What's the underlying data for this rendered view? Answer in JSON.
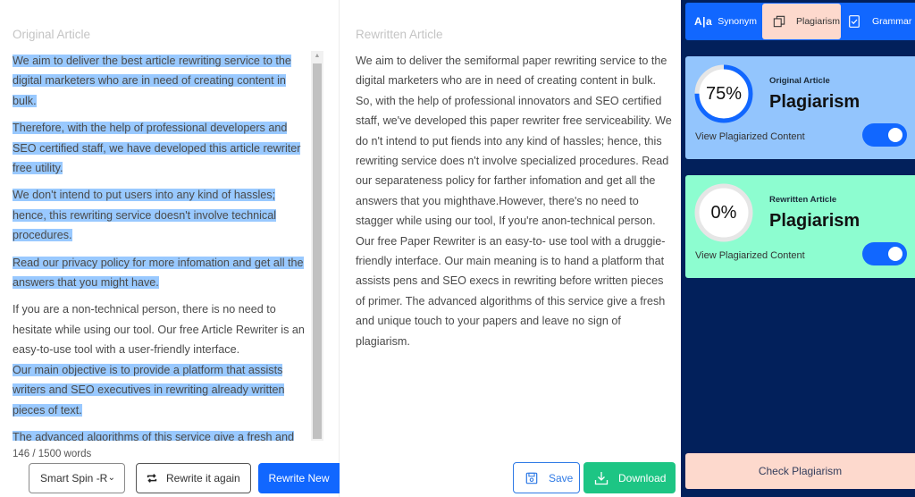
{
  "original": {
    "title": "Original Article",
    "paragraphs": [
      {
        "text": "We aim to deliver the best article rewriting service to the digital marketers who are in need of creating content in bulk.",
        "highlighted": true
      },
      {
        "text": "Therefore, with the help of professional developers and SEO certified staff, we have developed this article rewriter free utility.",
        "highlighted": true
      },
      {
        "text": "We don't intend to put users into any kind of hassles; hence, this rewriting service doesn't involve technical procedures.",
        "highlighted": true
      },
      {
        "text": "Read our privacy policy for more infomation and get all the answers that you might have.",
        "highlighted": true
      },
      {
        "text": "If you are a non-technical person, there is no need to hesitate while using our tool. Our free Article Rewriter is an easy-to-use tool with a user-friendly interface.",
        "highlighted": false
      },
      {
        "text": "Our main objective is to provide a platform that assists writers and SEO executives in rewriting already written pieces of text.",
        "highlighted": true
      },
      {
        "text": "The advanced algorithms of this service give a fresh and unique touch to your papers and leave no sign of plagiarism.",
        "highlighted": true
      }
    ],
    "word_count": "146 / 1500 words",
    "mode_select": "Smart Spin -R",
    "rewrite_again_label": "Rewrite it again",
    "rewrite_new_label": "Rewrite New"
  },
  "rewritten": {
    "title": "Rewritten Article",
    "text": "We aim to deliver the semiformal paper rewriting service to the digital marketers who are in need of creating content in bulk. So, with the help of professional innovators and SEO certified staff, we've developed this paper rewriter free serviceability. We do n't intend to put fiends into any kind of hassles; hence, this rewriting service does n't involve specialized procedures. Read our separateness policy for farther infomation and get all the answers that you mighthave.However, there's no need to stagger while using our tool, If you're anon-technical person. Our free Paper Rewriter is an easy-to- use tool with a druggie- friendly interface. Our main meaning is to hand a platform that assists pens and SEO execs in rewriting before written pieces of primer. The advanced algorithms of this service give a fresh and unique touch to your papers and leave no sign of plagiarism.",
    "save_label": "Save",
    "download_label": "Download"
  },
  "sidebar": {
    "tabs": [
      {
        "label": "Synonym",
        "icon": "text-compare-icon",
        "active": false
      },
      {
        "label": "Plagiarism",
        "icon": "copy-pages-icon",
        "active": true
      },
      {
        "label": "Grammar",
        "icon": "checkbox-icon",
        "active": false
      }
    ],
    "cards": [
      {
        "subtitle": "Original Article",
        "title": "Plagiarism",
        "percent_label": "75%",
        "percent": 75,
        "link": "View Plagiarized Content",
        "toggle_on": true,
        "bg": "#93c5fd"
      },
      {
        "subtitle": "Rewritten Article",
        "title": "Plagiarism",
        "percent_label": "0%",
        "percent": 0,
        "link": "View Plagiarized Content",
        "toggle_on": true,
        "bg": "#8dfdd0"
      }
    ],
    "check_label": "Check Plagiarism"
  },
  "colors": {
    "accent": "#1167ff",
    "download": "#1dc584",
    "sidebar_bg": "#02205b",
    "highlight": "#99c9ff",
    "active_tab": "#fdd9cd"
  }
}
